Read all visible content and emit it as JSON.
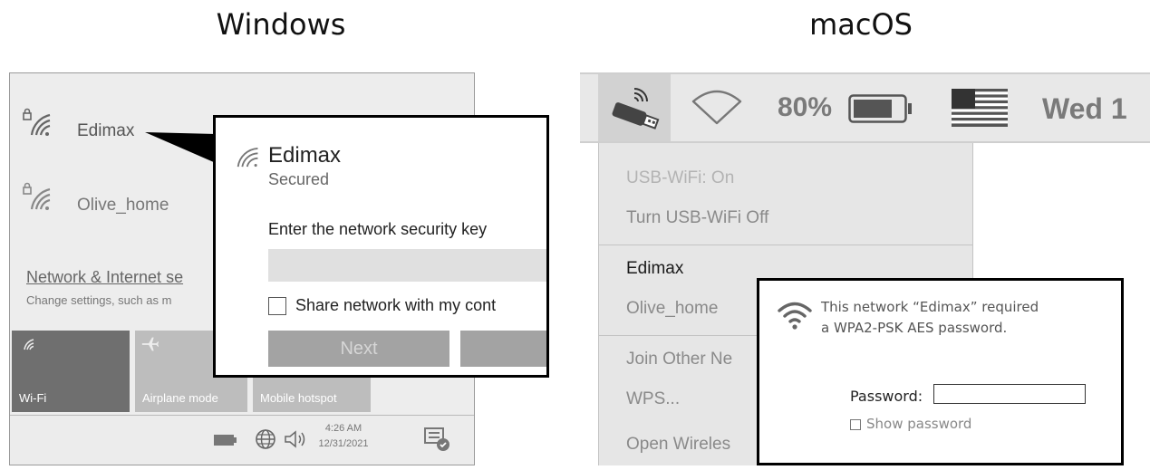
{
  "headings": {
    "windows": "Windows",
    "macos": "macOS"
  },
  "windows": {
    "networks": [
      {
        "name": "Edimax"
      },
      {
        "name": "Olive_home"
      }
    ],
    "settings_link": "Network & Internet se",
    "settings_sub": "Change settings, such as m",
    "tiles": [
      {
        "label": "Wi-Fi"
      },
      {
        "label": "Airplane mode"
      },
      {
        "label": "Mobile hotspot"
      }
    ],
    "taskbar": {
      "time": "4:26 AM",
      "date": "12/31/2021"
    },
    "popup": {
      "network": "Edimax",
      "status": "Secured",
      "prompt": "Enter the network security key",
      "key_value": "",
      "share_label": "Share network with my cont",
      "next_label": "Next",
      "cancel_label": ""
    }
  },
  "macos": {
    "battery": "80%",
    "clock": "Wed 1",
    "menu": {
      "status": "USB-WiFi: On",
      "toggle": "Turn USB-WiFi Off",
      "networks": [
        "Edimax",
        "Olive_home"
      ],
      "join": "Join Other Ne",
      "wps": "WPS...",
      "open": "Open Wireles"
    },
    "popup": {
      "message_line1": "This network “Edimax” required",
      "message_line2": "a WPA2-PSK AES password.",
      "password_label": "Password:",
      "password_value": "",
      "show_password_label": "Show password"
    }
  }
}
